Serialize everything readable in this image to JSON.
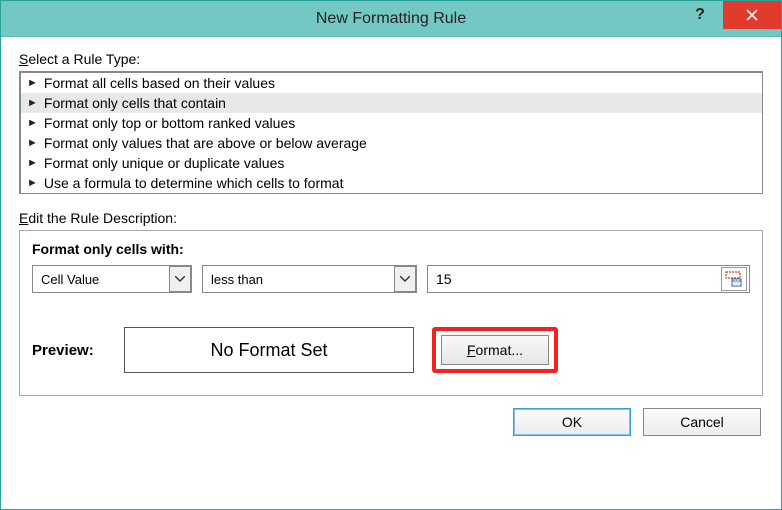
{
  "window": {
    "title": "New Formatting Rule",
    "help_symbol": "?",
    "close_label": "Close"
  },
  "select_label_pre": "S",
  "select_label_post": "elect a Rule Type:",
  "rule_types": [
    "Format all cells based on their values",
    "Format only cells that contain",
    "Format only top or bottom ranked values",
    "Format only values that are above or below average",
    "Format only unique or duplicate values",
    "Use a formula to determine which cells to format"
  ],
  "selected_rule_index": 1,
  "edit_label_pre": "E",
  "edit_label_post": "dit the Rule Description:",
  "desc": {
    "heading": "Format only cells with:",
    "combo1": "Cell Value",
    "combo2": "less than",
    "input_value": "15",
    "preview_label": "Preview:",
    "preview_text": "No Format Set",
    "format_pre": "F",
    "format_post": "ormat..."
  },
  "buttons": {
    "ok": "OK",
    "cancel": "Cancel"
  }
}
